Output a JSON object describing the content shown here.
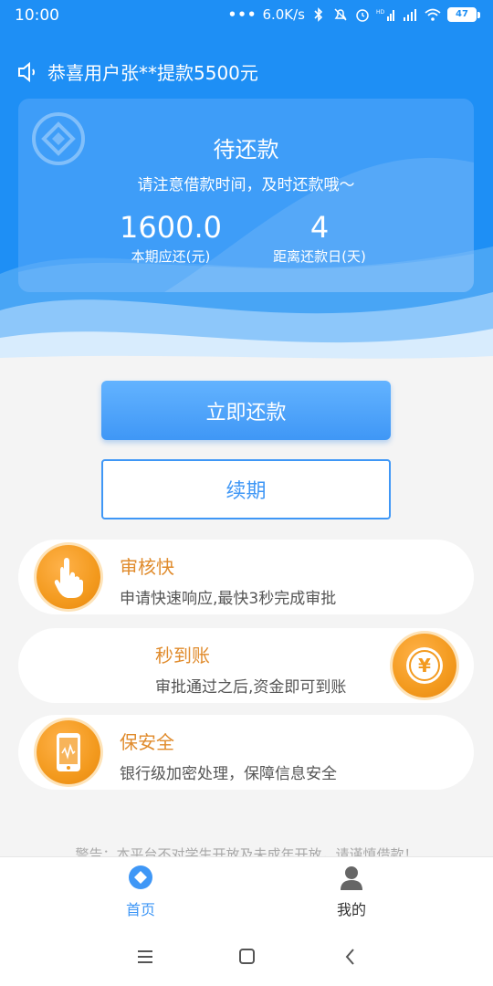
{
  "status_bar": {
    "time": "10:00",
    "net_speed": "6.0K/s",
    "battery": "47",
    "icons": [
      "dots-icon",
      "bluetooth-icon",
      "mute-icon",
      "alarm-icon",
      "hd-signal-icon",
      "signal-icon",
      "wifi-icon",
      "battery-icon"
    ]
  },
  "notice": {
    "text": "恭喜用户张**提款5500元",
    "icon": "speaker-icon"
  },
  "repay_card": {
    "title": "待还款",
    "subtitle": "请注意借款时间，及时还款哦～",
    "amount_value": "1600.0",
    "amount_label": "本期应还(元)",
    "days_value": "4",
    "days_label": "距离还款日(天)"
  },
  "actions": {
    "repay_now": "立即还款",
    "renew": "续期"
  },
  "features": [
    {
      "title": "审核快",
      "desc": "申请快速响应,最快3秒完成审批",
      "icon": "hand-pointer-icon"
    },
    {
      "title": "秒到账",
      "desc": "审批通过之后,资金即可到账",
      "icon": "yuan-coin-icon"
    },
    {
      "title": "保安全",
      "desc": "银行级加密处理，保障信息安全",
      "icon": "phone-shield-icon"
    }
  ],
  "warning": "警告：本平台不对学生开放及未成年开放，请谨慎借款！",
  "tabs": [
    {
      "label": "首页",
      "icon": "home-diamond-icon",
      "active": true
    },
    {
      "label": "我的",
      "icon": "user-icon",
      "active": false
    }
  ],
  "colors": {
    "primary": "#3f97f6",
    "header_blue": "#1e8ff5",
    "accent_orange": "#f39a1e",
    "feature_title": "#e08b2c"
  }
}
